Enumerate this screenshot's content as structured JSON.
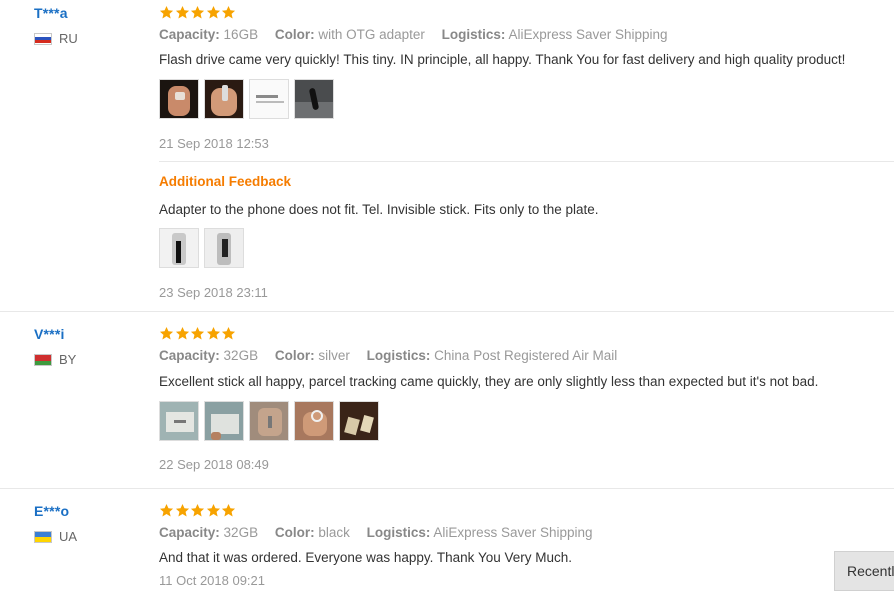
{
  "labels": {
    "capacity": "Capacity:",
    "color": "Color:",
    "logistics": "Logistics:",
    "additional_feedback": "Additional Feedback"
  },
  "colors": {
    "star": "#f7a300",
    "username": "#1a6fc4",
    "additional_feedback": "#f57c00"
  },
  "reviews": [
    {
      "user": "T***a",
      "country": "RU",
      "rating": 5,
      "capacity": "16GB",
      "color": "with OTG adapter",
      "logistics": "AliExpress Saver Shipping",
      "text": "Flash drive came very quickly! This tiny. IN principle, all happy. Thank You for fast delivery and high quality product!",
      "date": "21 Sep 2018 12:53",
      "additional": {
        "text": "Adapter to the phone does not fit. Tel. Invisible stick. Fits only to the plate.",
        "date": "23 Sep 2018 23:11"
      }
    },
    {
      "user": "V***i",
      "country": "BY",
      "rating": 5,
      "capacity": "32GB",
      "color": "silver",
      "logistics": "China Post Registered Air Mail",
      "text": "Excellent stick all happy, parcel tracking came quickly, they are only slightly less than expected but it's not bad.",
      "date": "22 Sep 2018 08:49"
    },
    {
      "user": "E***o",
      "country": "UA",
      "rating": 5,
      "capacity": "32GB",
      "color": "black",
      "logistics": "AliExpress Saver Shipping",
      "text": "And that it was ordered. Everyone was happy. Thank You Very Much.",
      "date": "11 Oct 2018 09:21"
    }
  ],
  "recently_viewed_label": "Recently Viewed"
}
